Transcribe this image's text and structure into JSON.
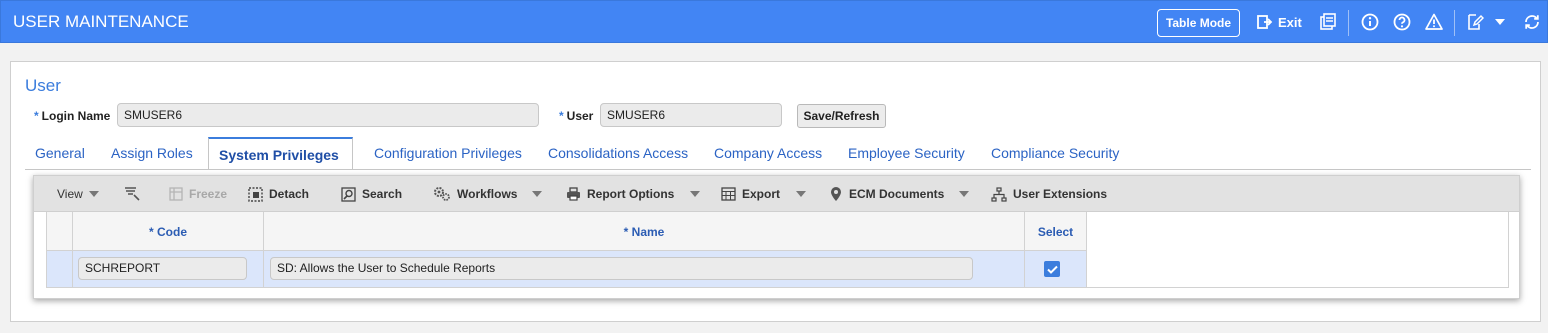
{
  "header": {
    "title": "USER MAINTENANCE",
    "table_mode_label": "Table Mode",
    "exit_label": "Exit",
    "icons": [
      "exit-icon",
      "print-icon",
      "info-icon",
      "help-icon",
      "warning-icon",
      "edit-icon",
      "dropdown-icon",
      "refresh-icon"
    ]
  },
  "form": {
    "title": "User",
    "required_marker": "*",
    "login_name_label": "Login Name",
    "login_name_value": "SMUSER6",
    "user_label": "User",
    "user_value": "SMUSER6",
    "save_refresh_label": "Save/Refresh"
  },
  "tabs": [
    {
      "label": "General"
    },
    {
      "label": "Assign Roles"
    },
    {
      "label": "System Privileges",
      "active": true
    },
    {
      "label": "Configuration Privileges"
    },
    {
      "label": "Consolidations Access"
    },
    {
      "label": "Company Access"
    },
    {
      "label": "Employee Security"
    },
    {
      "label": "Compliance Security"
    }
  ],
  "toolbar": {
    "view_label": "View",
    "freeze_label": "Freeze",
    "detach_label": "Detach",
    "search_label": "Search",
    "workflows_label": "Workflows",
    "report_options_label": "Report Options",
    "export_label": "Export",
    "ecm_documents_label": "ECM Documents",
    "user_extensions_label": "User Extensions"
  },
  "grid": {
    "columns": [
      "* Code",
      "* Name",
      "Select"
    ],
    "rows": [
      {
        "code": "SCHREPORT",
        "name": "SD: Allows the User to Schedule Reports",
        "selected": true
      }
    ]
  },
  "colors": {
    "header_bg": "#4285f4",
    "accent": "#3b7ddd",
    "selected_row": "#dbe6fb"
  }
}
